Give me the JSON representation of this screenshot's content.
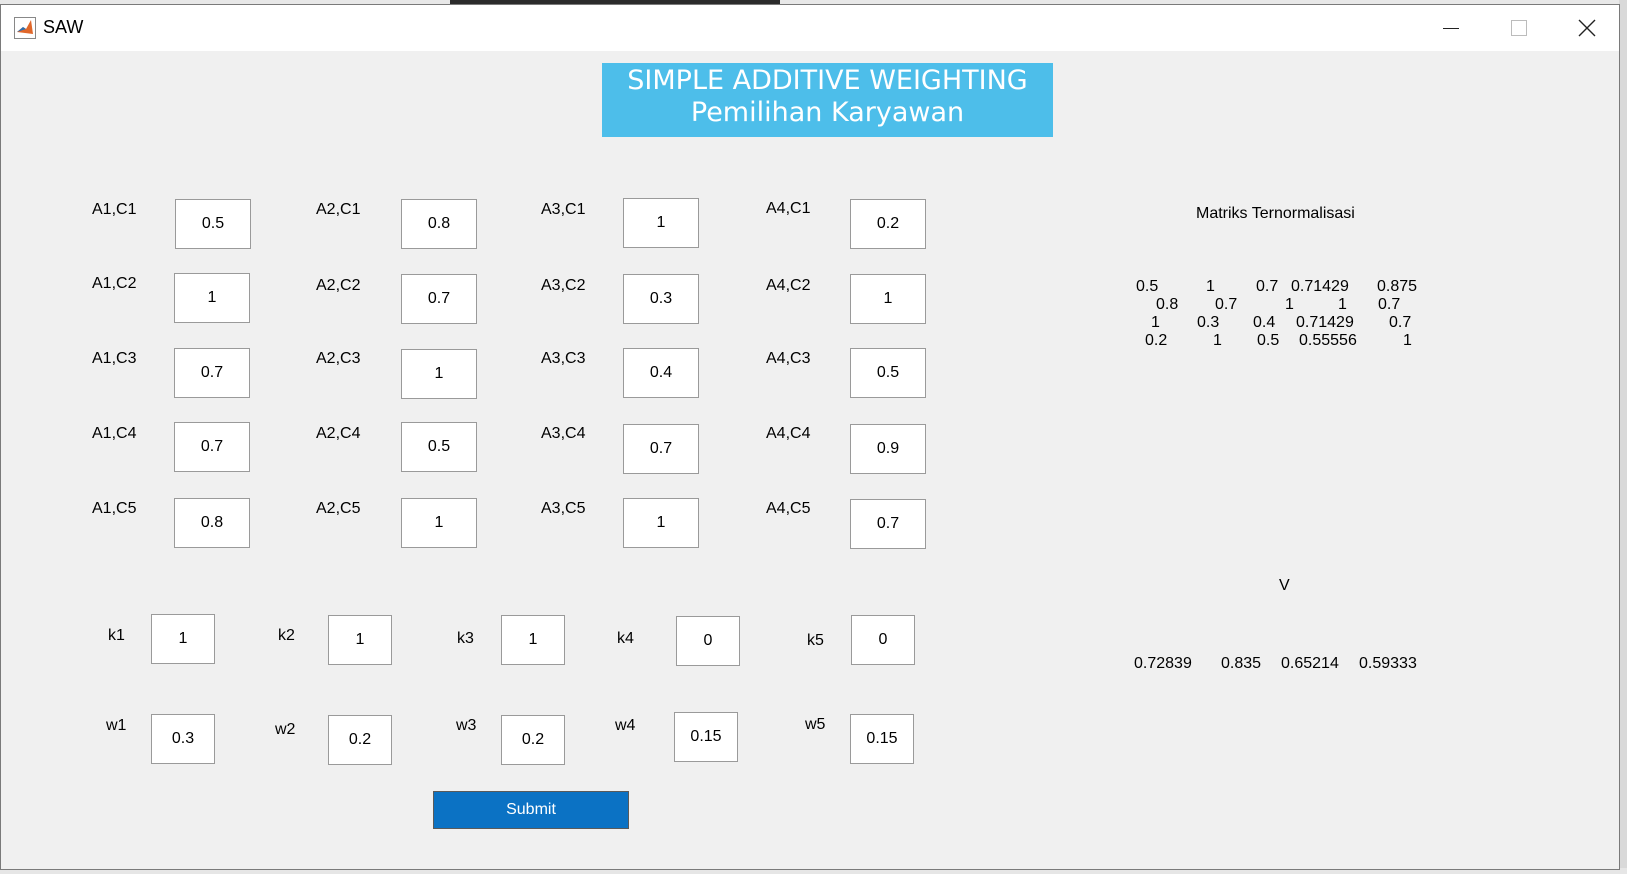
{
  "window": {
    "title": "SAW"
  },
  "header": {
    "line1": "SIMPLE ADDITIVE WEIGHTING",
    "line2": "Pemilihan Karyawan"
  },
  "matrix_inputs": [
    {
      "label": "A1,C1",
      "value": "0.5"
    },
    {
      "label": "A2,C1",
      "value": "0.8"
    },
    {
      "label": "A3,C1",
      "value": "1"
    },
    {
      "label": "A4,C1",
      "value": "0.2"
    },
    {
      "label": "A1,C2",
      "value": "1"
    },
    {
      "label": "A2,C2",
      "value": "0.7"
    },
    {
      "label": "A3,C2",
      "value": "0.3"
    },
    {
      "label": "A4,C2",
      "value": "1"
    },
    {
      "label": "A1,C3",
      "value": "0.7"
    },
    {
      "label": "A2,C3",
      "value": "1"
    },
    {
      "label": "A3,C3",
      "value": "0.4"
    },
    {
      "label": "A4,C3",
      "value": "0.5"
    },
    {
      "label": "A1,C4",
      "value": "0.7"
    },
    {
      "label": "A2,C4",
      "value": "0.5"
    },
    {
      "label": "A3,C4",
      "value": "0.7"
    },
    {
      "label": "A4,C4",
      "value": "0.9"
    },
    {
      "label": "A1,C5",
      "value": "0.8"
    },
    {
      "label": "A2,C5",
      "value": "1"
    },
    {
      "label": "A3,C5",
      "value": "1"
    },
    {
      "label": "A4,C5",
      "value": "0.7"
    }
  ],
  "k_inputs": [
    {
      "label": "k1",
      "value": "1"
    },
    {
      "label": "k2",
      "value": "1"
    },
    {
      "label": "k3",
      "value": "1"
    },
    {
      "label": "k4",
      "value": "0"
    },
    {
      "label": "k5",
      "value": "0"
    }
  ],
  "w_inputs": [
    {
      "label": "w1",
      "value": "0.3"
    },
    {
      "label": "w2",
      "value": "0.2"
    },
    {
      "label": "w3",
      "value": "0.2"
    },
    {
      "label": "w4",
      "value": "0.15"
    },
    {
      "label": "w5",
      "value": "0.15"
    }
  ],
  "normalized": {
    "title": "Matriks Ternormalisasi",
    "rows": [
      [
        "0.5",
        "1",
        "0.7",
        "0.71429",
        "0.875"
      ],
      [
        "0.8",
        "0.7",
        "1",
        "1",
        "0.7"
      ],
      [
        "1",
        "0.3",
        "0.4",
        "0.71429",
        "0.7"
      ],
      [
        "0.2",
        "1",
        "0.5",
        "0.55556",
        "1"
      ]
    ]
  },
  "result": {
    "title": "V",
    "values": [
      "0.72839",
      "0.835",
      "0.65214",
      "0.59333"
    ]
  },
  "submit_label": "Submit"
}
